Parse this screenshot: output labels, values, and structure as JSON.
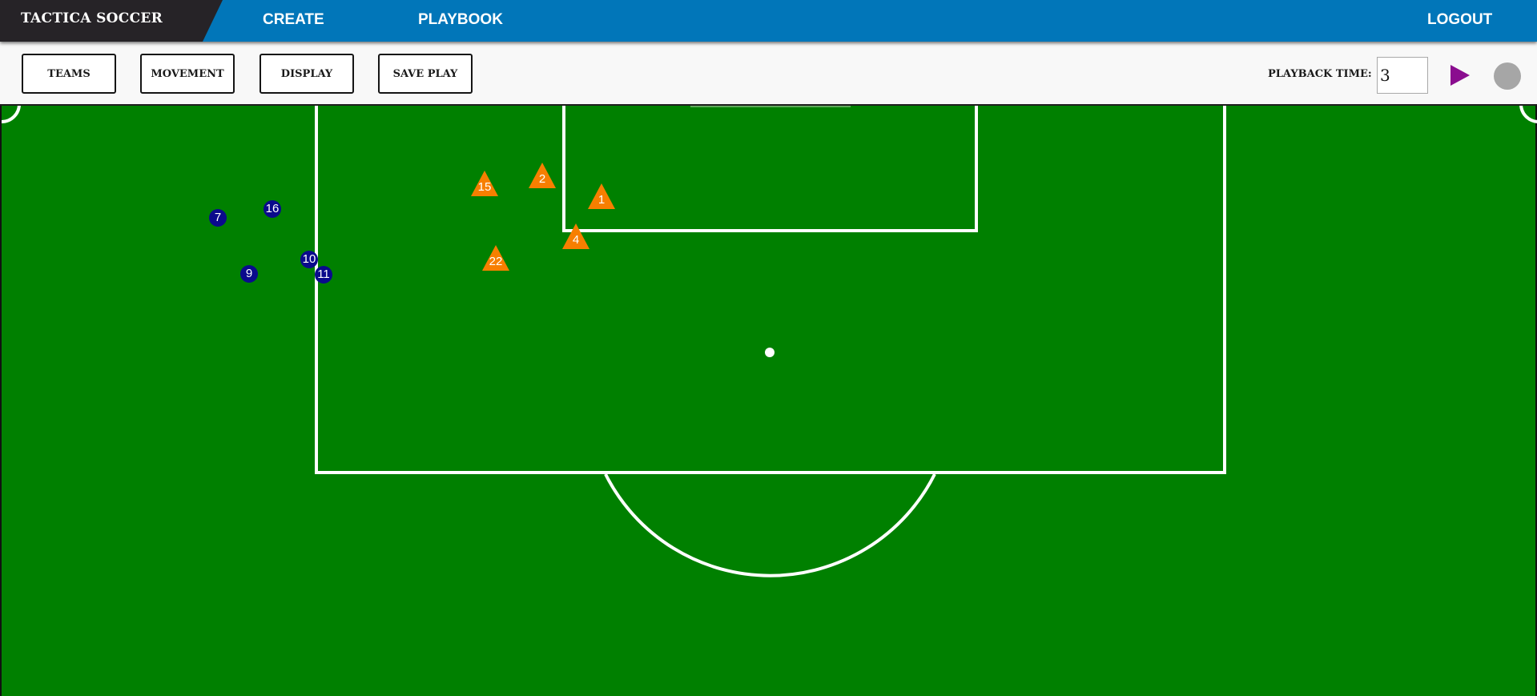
{
  "nav": {
    "brand": "TACTICA SOCCER",
    "links": [
      {
        "label": "CREATE"
      },
      {
        "label": "PLAYBOOK"
      }
    ],
    "logout": "LOGOUT"
  },
  "toolbar": {
    "buttons": [
      {
        "label": "TEAMS"
      },
      {
        "label": "MOVEMENT"
      },
      {
        "label": "DISPLAY"
      },
      {
        "label": "SAVE PLAY"
      }
    ],
    "playback_label": "PLAYBACK TIME:",
    "playback_value": "3",
    "play_icon": "play-icon",
    "stop_icon": "stop-icon"
  },
  "colors": {
    "nav_bg": "#0176b9",
    "brand_bg": "#262327",
    "field": "#008000",
    "home_team": "#0a0a8c",
    "away_team": "#f77f00",
    "play": "#8a0d8f",
    "stop": "#a6a6a6"
  },
  "field": {
    "blue_players": [
      "7",
      "16",
      "9",
      "10",
      "11"
    ],
    "orange_players": [
      "15",
      "2",
      "1",
      "4",
      "22"
    ]
  }
}
